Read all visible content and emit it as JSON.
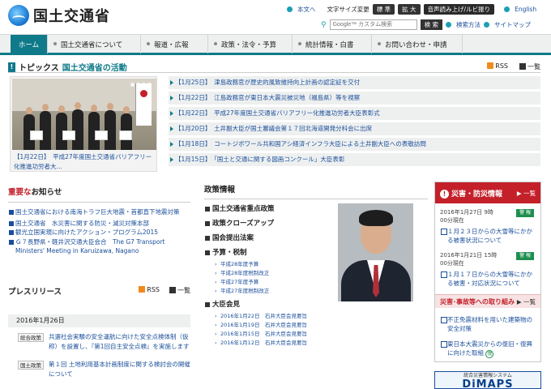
{
  "header": {
    "site_name": "国土交通省",
    "util": {
      "honbun": "本文へ",
      "font_size_label": "文字サイズ変更",
      "font_standard": "標 準",
      "font_large": "拡 大",
      "speech": "音声読み上げ/ルビ振り",
      "english": "English",
      "search_placeholder": "Google™ カスタム検索",
      "search_button": "検 索",
      "search_method": "検索方法",
      "sitemap": "サイトマップ"
    }
  },
  "nav": {
    "items": [
      {
        "label": "ホーム"
      },
      {
        "label": "国土交通省について"
      },
      {
        "label": "報道・広報"
      },
      {
        "label": "政策・法令・予算"
      },
      {
        "label": "統計情報・白書"
      },
      {
        "label": "お問い合わせ・申請"
      }
    ]
  },
  "topics": {
    "title": "トピックス",
    "subtitle": "国土交通省の活動",
    "rss": "RSS",
    "list_label": "一覧",
    "photo_caption": "【1月22日】　平成27年度国土交通省バリアフリー化推進功労者大...",
    "items": [
      {
        "text": "【1月25日】　津島政務官が歴史的風致維持向上計画の認定証を交付"
      },
      {
        "text": "【1月22日】　江島政務官が東日本大震災被災地（福島県）等を視察"
      },
      {
        "text": "【1月22日】　平成27年度国土交通省バリアフリー化推進功労者大臣表彰式"
      },
      {
        "text": "【1月20日】　土井副大臣が国土審議会第１７回北海道開発分科会に出席"
      },
      {
        "text": "【1月18日】　コートジボワール共和国アシ経済インフラ大臣による土井副大臣への表敬訪問"
      },
      {
        "text": "【1月15日】　「国土と交通に関する図画コンクール」大臣表彰"
      }
    ]
  },
  "notices": {
    "title_red": "重要な",
    "title_rest": "お知らせ",
    "items": [
      {
        "text": "国土交通省における南海トラフ巨大地震・首都直下地震対策"
      },
      {
        "text": "国土交通省　水災害に関する防災・減災対策本部"
      },
      {
        "text": "観光立国実現に向けたアクション・プログラム2015"
      },
      {
        "text": "Ｇ７長野県・軽井沢交通大臣会合　The G7 Transport Ministers' Meeting in Karuizawa, Nagano"
      }
    ]
  },
  "press": {
    "title": "プレスリリース",
    "rss": "RSS",
    "list_label": "一覧",
    "date": "2016年1月26日",
    "items": [
      {
        "category": "総合政策",
        "text": "共選社会実験の安全運航に向けた安全点検体制（仮称）を設置し、『第1回自主安全点検』を実施します"
      },
      {
        "category": "国土政策",
        "text": "第１回 土地利用基本計画制度に関する検討会の開催について"
      }
    ]
  },
  "policy": {
    "title": "政策情報",
    "heads": {
      "priority": "国土交通省重点政策",
      "closeup": "政策クローズアップ",
      "bills": "国会提出法案",
      "budget": "予算・税制",
      "press_conf": "大臣会見"
    },
    "budget_items": [
      {
        "text": "平成28年度予算"
      },
      {
        "text": "平成28年度税制改正"
      },
      {
        "text": "平成27年度予算"
      },
      {
        "text": "平成27年度税制改正"
      }
    ],
    "conf_items": [
      {
        "text": "2016年1月22日　石井大臣会見要旨"
      },
      {
        "text": "2016年1月19日　石井大臣会見要旨"
      },
      {
        "text": "2016年1月15日　石井大臣会見要旨"
      },
      {
        "text": "2016年1月12日　石井大臣会見要旨"
      }
    ]
  },
  "disaster": {
    "title": "災害・防災情報",
    "list_label": "一覧",
    "entries": [
      {
        "date": "2016年1月27日 9時",
        "time_suffix": "00分現在",
        "badge": "警 報",
        "link": "１月２３日からの大雪等にかかる被害状況について"
      },
      {
        "date": "2016年1月21日 15時",
        "time_suffix": "00分現在",
        "badge": "警 報",
        "link": "１月１７日からの大雪等にかかる被害・対応状況について"
      }
    ],
    "sub_title": "災害･事故等への取り組み",
    "sub_list_label": "一覧",
    "sub_items": [
      {
        "text": "不正免震材料を用いた建築物の安全対策"
      },
      {
        "text": "東日本大震災からの復旧・復興に向けた取組"
      }
    ],
    "sub_badge": "復"
  },
  "dimaps": {
    "top": "統合災害情報システム",
    "big": "DiMAPS"
  },
  "colors": {
    "teal": "#0f7a8a",
    "red": "#c4202a",
    "link": "#1a4e9a"
  }
}
